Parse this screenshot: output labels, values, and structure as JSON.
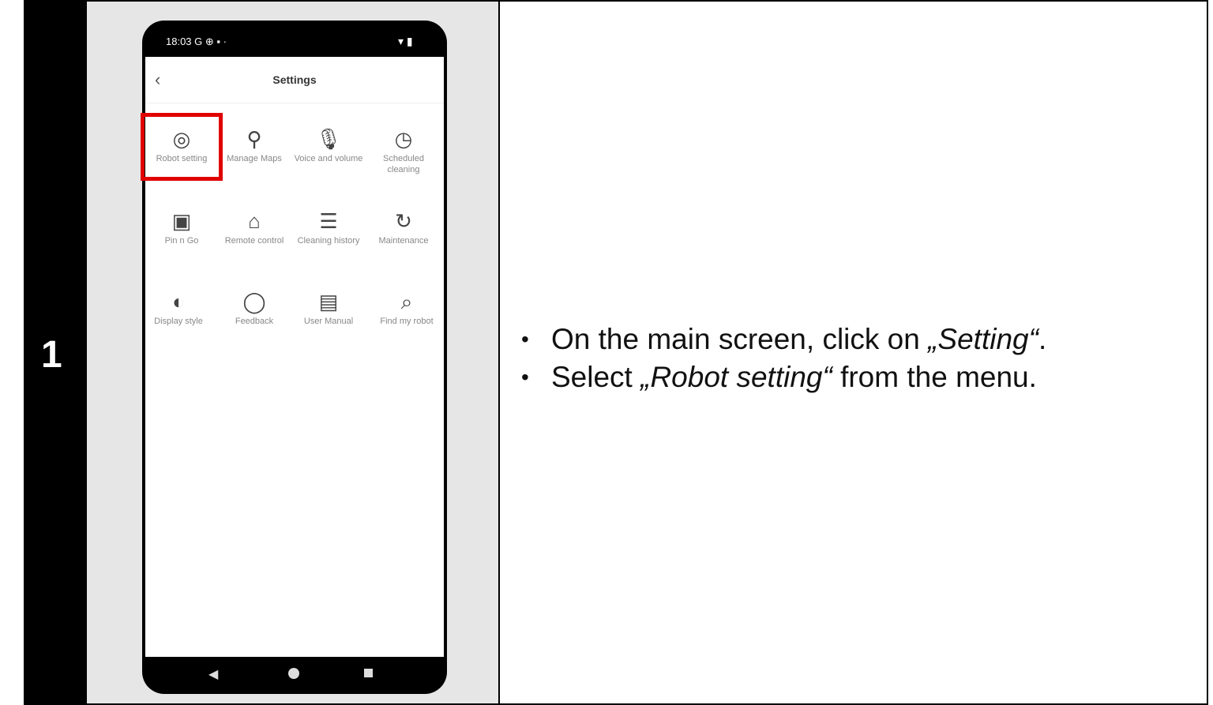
{
  "step": {
    "number": "1"
  },
  "phone": {
    "status_time": "18:03",
    "status_icons": "G ⊕ ▪ ·",
    "status_right": "▾ ▮",
    "title": "Settings",
    "back_glyph": "‹",
    "grid": [
      {
        "label": "Robot setting",
        "icon": "robot-icon",
        "glyph": "◎"
      },
      {
        "label": "Manage Maps",
        "icon": "map-icon",
        "glyph": "⚲"
      },
      {
        "label": "Voice and volume",
        "icon": "microphone-icon",
        "glyph": "🎙"
      },
      {
        "label": "Scheduled cleaning",
        "icon": "clock-icon",
        "glyph": "◷"
      },
      {
        "label": "Pin n Go",
        "icon": "pin-icon",
        "glyph": "▣"
      },
      {
        "label": "Remote control",
        "icon": "remote-icon",
        "glyph": "⌂"
      },
      {
        "label": "Cleaning history",
        "icon": "history-icon",
        "glyph": "☰"
      },
      {
        "label": "Maintenance",
        "icon": "maintenance-icon",
        "glyph": "↻"
      },
      {
        "label": "Display style",
        "icon": "palette-icon",
        "glyph": "◐"
      },
      {
        "label": "Feedback",
        "icon": "feedback-icon",
        "glyph": "◯"
      },
      {
        "label": "User Manual",
        "icon": "manual-icon",
        "glyph": "▤"
      },
      {
        "label": "Find my robot",
        "icon": "find-robot-icon",
        "glyph": "⌕"
      }
    ],
    "highlight_color": "#e00000"
  },
  "instructions": {
    "bullet1_prefix": "On the main screen, click on ",
    "bullet1_em": "„Setting“",
    "bullet1_suffix": ".",
    "bullet2_prefix": "Select ",
    "bullet2_em": "„Robot setting“",
    "bullet2_suffix": " from the menu."
  }
}
